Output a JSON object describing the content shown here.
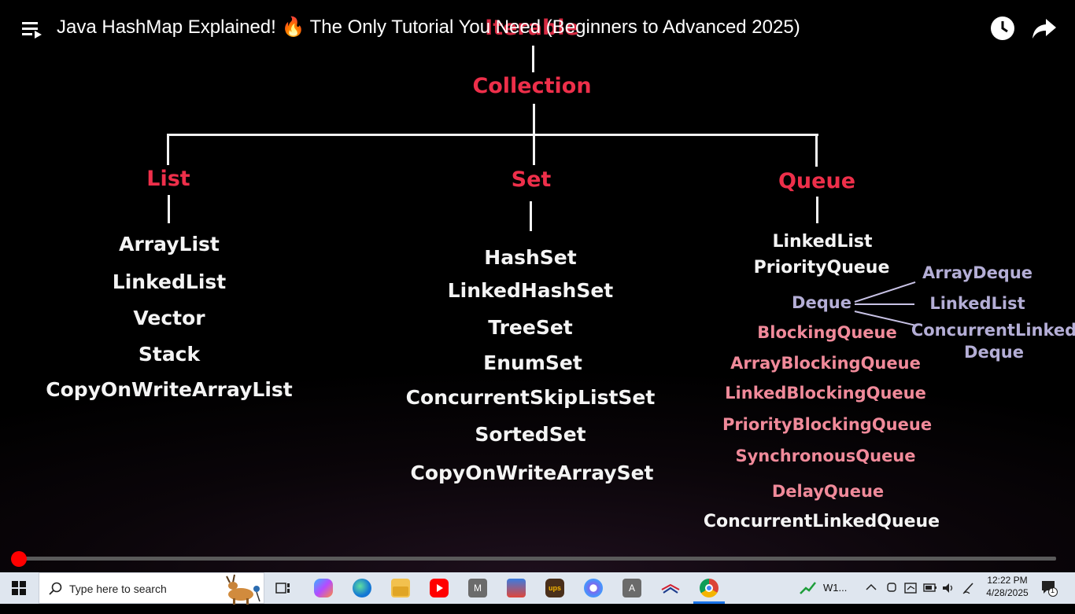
{
  "video": {
    "title": "Java HashMap Explained! 🔥 The Only Tutorial You Need (Beginners to Advanced 2025)",
    "root_partial": "Iterable",
    "collection": "Collection",
    "list": {
      "label": "List",
      "items": [
        "ArrayList",
        "LinkedList",
        "Vector",
        "Stack",
        "CopyOnWriteArrayList"
      ]
    },
    "set": {
      "label": "Set",
      "items": [
        "HashSet",
        "LinkedHashSet",
        "TreeSet",
        "EnumSet",
        "ConcurrentSkipListSet",
        "SortedSet",
        "CopyOnWriteArraySet"
      ]
    },
    "queue": {
      "label": "Queue",
      "items": [
        "LinkedList",
        "PriorityQueue"
      ],
      "deque": "Deque",
      "deque_items": [
        "ArrayDeque",
        "LinkedList",
        "ConcurrentLinked",
        "Deque"
      ],
      "blocking": "BlockingQueue",
      "blocking_items": [
        "ArrayBlockingQueue",
        "LinkedBlockingQueue",
        "PriorityBlockingQueue",
        "SynchronousQueue",
        "DelayQueue"
      ],
      "last": "ConcurrentLinkedQueue"
    },
    "progress_fraction": 0.0
  },
  "taskbar": {
    "search_placeholder": "Type here to search",
    "tray_app_label": "W1...",
    "time": "12:22 PM",
    "date": "4/28/2025",
    "notification_count": "1"
  },
  "colors": {
    "accent_red": "#ee2f4a",
    "pink": "#f08a9a",
    "lavender": "#b4aed6",
    "progress": "#ff0000"
  }
}
